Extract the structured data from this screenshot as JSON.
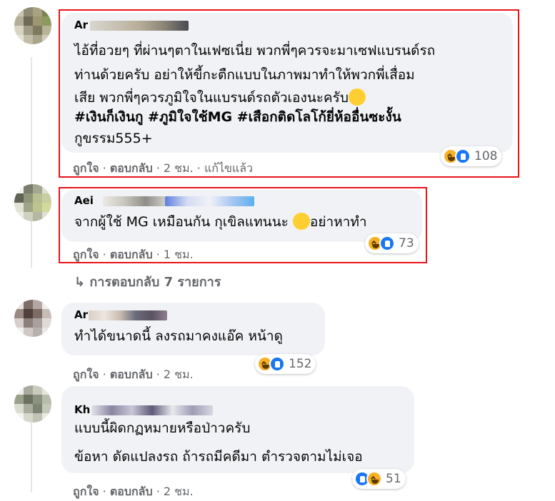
{
  "comments": [
    {
      "author": "Ar",
      "lines": [
        "ไอ้ที่อวยๆ ที่ผ่านๆตาในเฟซเนี่ย พวกพี่ๆควรจะมาเซฟแบรนด์รถ",
        "ท่านด้วยครับ อย่าให้ขี้กะตืกแบบในภาพมาทำให้พวกพี่เสื่อม",
        "เสีย พวกพี่ๆควรภูมิใจในแบรนด์รถตัวเองนะครับ"
      ],
      "hashtags": "#เงินก็เงินกู #ภูมิใจใช้MG #เสือกติดโลโก้ยี่ห้ออื่นซะงั้น",
      "tail": "กูขรรม555+",
      "like_label": "ถูกใจ",
      "reply_label": "ตอบกลับ",
      "time": "· 2 ชม. ·",
      "edited": "แก้ไขแล้ว",
      "reaction_count": "108"
    },
    {
      "author": "Aei",
      "lines": [
        "จากผู้ใช้ MG เหมือนกัน กุเขิลแทนนะ",
        "อย่าหาทำ"
      ],
      "like_label": "ถูกใจ",
      "reply_label": "ตอบกลับ",
      "time": "· 1 ชม.",
      "reaction_count": "73"
    },
    {
      "author": "Ar",
      "lines": [
        "ทำได้ขนาดนี้ ลงรถมาคงแอ๊ค หน้าดู"
      ],
      "like_label": "ถูกใจ",
      "reply_label": "ตอบกลับ",
      "time": "· 2 ชม.",
      "reaction_count": "152"
    },
    {
      "author": "Kh",
      "lines": [
        "แบบนี้ผิดกฏหมายหรือป่าวครับ",
        "ข้อหา ดัดแปลงรถ ถ้ารถมีคดีมา ตำรวจตามไม่เจอ"
      ],
      "like_label": "ถูกใจ",
      "reply_label": "ตอบกลับ",
      "time": "· 2 ชม.",
      "reaction_count": "51"
    }
  ],
  "replies_link": "การตอบกลับ 7 รายการ",
  "colors": {
    "bubble": "#f0f2f5",
    "highlight_border": "#e8141b",
    "meta_text": "#65676b",
    "like_blue": "#1877f2",
    "haha_yellow": "#f7b125"
  }
}
